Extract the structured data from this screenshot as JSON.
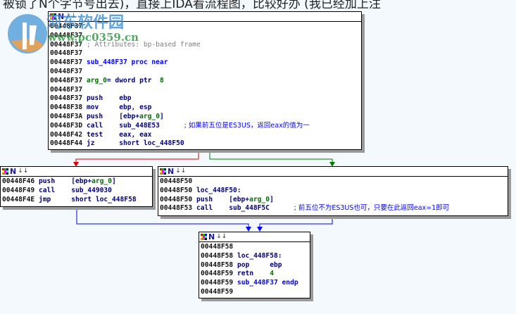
{
  "caption": "被锁了N个字节号出去)，直接上IDA看流程图，比较好办 (我已经加上注",
  "watermark": {
    "title": "河东软件园",
    "url": "www.pc0359.cn"
  },
  "colors": {
    "true_edge": "#00a000",
    "false_edge": "#e00000",
    "jump_edge": "#0000ff"
  },
  "blocks": [
    {
      "id": "top",
      "header": "N",
      "lines": [
        [
          {
            "t": "00448F37",
            "c": "addr"
          }
        ],
        [
          {
            "t": "00448F37",
            "c": "addr"
          }
        ],
        [
          {
            "t": "00448F37",
            "c": "addr"
          },
          {
            "t": " ; Attributes: bp-based frame",
            "c": "c-cmt"
          }
        ],
        [
          {
            "t": "00448F37",
            "c": "addr"
          }
        ],
        [
          {
            "t": "00448F37",
            "c": "addr"
          },
          {
            "t": " sub_448F37 proc near",
            "c": "c-name"
          }
        ],
        [
          {
            "t": "00448F37",
            "c": "addr"
          }
        ],
        [
          {
            "t": "00448F37",
            "c": "addr"
          },
          {
            "t": " arg_0",
            "c": "c-arg"
          },
          {
            "t": "= dword ptr  ",
            "c": "c-kw"
          },
          {
            "t": "8",
            "c": "c-num"
          }
        ],
        [
          {
            "t": "00448F37",
            "c": "addr"
          }
        ],
        [
          {
            "t": "00448F37",
            "c": "addr"
          },
          {
            "t": " push    ebp",
            "c": "c-kw"
          }
        ],
        [
          {
            "t": "00448F38",
            "c": "addr"
          },
          {
            "t": " mov     ebp, esp",
            "c": "c-kw"
          }
        ],
        [
          {
            "t": "00448F3A",
            "c": "addr"
          },
          {
            "t": " push    [ebp+",
            "c": "c-kw"
          },
          {
            "t": "arg_0",
            "c": "c-arg"
          },
          {
            "t": "]",
            "c": "c-kw"
          }
        ],
        [
          {
            "t": "00448F3D",
            "c": "addr"
          },
          {
            "t": " call    sub_448E53      ",
            "c": "c-kw"
          },
          {
            "t": "; 如果前五位是ES3US，返回eax的值为一",
            "c": "c-zh"
          }
        ],
        [
          {
            "t": "00448F42",
            "c": "addr"
          },
          {
            "t": " test    eax, eax",
            "c": "c-kw"
          }
        ],
        [
          {
            "t": "00448F44",
            "c": "addr"
          },
          {
            "t": " jz      short loc_448F50",
            "c": "c-kw"
          }
        ]
      ]
    },
    {
      "id": "left",
      "header": "N",
      "lines": [
        [
          {
            "t": "00448F46",
            "c": "addr"
          },
          {
            "t": " push    [ebp+",
            "c": "c-kw"
          },
          {
            "t": "arg_0",
            "c": "c-arg"
          },
          {
            "t": "]",
            "c": "c-kw"
          }
        ],
        [
          {
            "t": "00448F49",
            "c": "addr"
          },
          {
            "t": " call    sub_449030",
            "c": "c-kw"
          }
        ],
        [
          {
            "t": "00448F4E",
            "c": "addr"
          },
          {
            "t": " jmp     short loc_448F58",
            "c": "c-kw"
          }
        ]
      ]
    },
    {
      "id": "right",
      "header": "N",
      "lines": [
        [
          {
            "t": "00448F50",
            "c": "addr"
          }
        ],
        [
          {
            "t": "00448F50",
            "c": "addr"
          },
          {
            "t": " loc_448F50:",
            "c": "c-kw"
          }
        ],
        [
          {
            "t": "00448F50",
            "c": "addr"
          },
          {
            "t": " push    [ebp+",
            "c": "c-kw"
          },
          {
            "t": "arg_0",
            "c": "c-arg"
          },
          {
            "t": "]",
            "c": "c-kw"
          }
        ],
        [
          {
            "t": "00448F53",
            "c": "addr"
          },
          {
            "t": " call    sub_448F5C      ",
            "c": "c-kw"
          },
          {
            "t": "; 前五位不为ES3US也可，只要在此返回eax=1即可",
            "c": "c-zh"
          }
        ]
      ]
    },
    {
      "id": "bottom",
      "header": "N",
      "lines": [
        [
          {
            "t": "00448F58",
            "c": "addr"
          }
        ],
        [
          {
            "t": "00448F58",
            "c": "addr"
          },
          {
            "t": " loc_448F58:",
            "c": "c-kw"
          }
        ],
        [
          {
            "t": "00448F58",
            "c": "addr"
          },
          {
            "t": " pop     ebp",
            "c": "c-kw"
          }
        ],
        [
          {
            "t": "00448F59",
            "c": "addr"
          },
          {
            "t": " retn    ",
            "c": "c-kw"
          },
          {
            "t": "4",
            "c": "c-num"
          }
        ],
        [
          {
            "t": "00448F59",
            "c": "addr"
          },
          {
            "t": " sub_448F37 endp",
            "c": "c-name"
          }
        ],
        [
          {
            "t": "00448F59",
            "c": "addr"
          }
        ]
      ]
    }
  ]
}
